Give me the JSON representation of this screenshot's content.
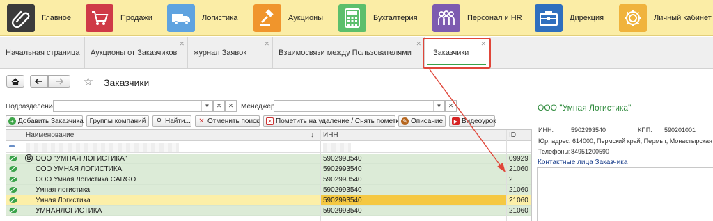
{
  "topnav": {
    "items": [
      {
        "label": "Главное",
        "icon": "paperclip-icon",
        "color": "#3b3b3b"
      },
      {
        "label": "Продажи",
        "icon": "cart-icon",
        "color": "#cf3a47"
      },
      {
        "label": "Логистика",
        "icon": "truck-icon",
        "color": "#5fa3e0"
      },
      {
        "label": "Аукционы",
        "icon": "gavel-icon",
        "color": "#f0952c"
      },
      {
        "label": "Бухгалтерия",
        "icon": "calculator-icon",
        "color": "#5cbf6c"
      },
      {
        "label": "Персонал и HR",
        "icon": "people-icon",
        "color": "#7d5bb0"
      },
      {
        "label": "Дирекция",
        "icon": "briefcase-icon",
        "color": "#2f6fbe"
      },
      {
        "label": "Личный кабинет",
        "icon": "gear-icon",
        "color": "#f0b33c"
      }
    ]
  },
  "tabs": [
    {
      "label": "Начальная страница",
      "closable": false
    },
    {
      "label": "Аукционы от Заказчиков",
      "closable": true
    },
    {
      "label": "журнал Заявок",
      "closable": true
    },
    {
      "label": "Взаимосвязи между Пользователями",
      "closable": true
    },
    {
      "label": "Заказчики",
      "closable": true,
      "active": true
    }
  ],
  "page": {
    "title": "Заказчики"
  },
  "filters": {
    "division_label": "Подразделение:",
    "division_value": "",
    "manager_label": "Менеджер:",
    "manager_value": ""
  },
  "toolbar": {
    "add": "Добавить Заказчика",
    "groups": "Группы компаний",
    "find": "Найти...",
    "cancel_search": "Отменить поиск",
    "mark_delete": "Пометить на удаление / Снять пометку",
    "description": "Описание",
    "video": "Видеоурок"
  },
  "grid": {
    "columns": {
      "name": "Наименование",
      "inn": "ИНН",
      "id": "ID"
    },
    "sort_indicator": "↓",
    "rows": [
      {
        "name": "ООО \"УМНАЯ ЛОГИСТИКА\"",
        "inn": "5902993540",
        "id": "09929",
        "style": "green",
        "badge": "B"
      },
      {
        "name": "ООО УМНАЯ ЛОГИСТИКА",
        "inn": "5902993540",
        "id": "21060",
        "style": "green"
      },
      {
        "name": "ООО Умная Логистика CARGO",
        "inn": "5902993540",
        "id": "2",
        "style": "green"
      },
      {
        "name": "Умная логистика",
        "inn": "5902993540",
        "id": "21060",
        "style": "green"
      },
      {
        "name": "Умная Логистика",
        "inn": "5902993540",
        "id": "21060",
        "style": "selected"
      },
      {
        "name": "УМНАЯЛОГИСТИКА",
        "inn": "5902993540",
        "id": "21060",
        "style": "green"
      }
    ]
  },
  "details": {
    "company": "ООО \"Умная Логистика\"",
    "inn_label": "ИНН:",
    "inn": "5902993540",
    "kpp_label": "КПП:",
    "kpp": "590201001",
    "address_label": "Юр. адрес:",
    "address": "614000, Пермский край, Пермь г, Монастырская",
    "phones_label": "Телефоны:",
    "phones": "84951200590",
    "contacts_title": "Контактные лица Заказчика"
  },
  "colors": {
    "accent_green": "#3aa24a",
    "highlight_red": "#e0463a",
    "row_green": "#dcebd7",
    "row_selected": "#fcefa8",
    "inn_selected": "#f5c842"
  }
}
